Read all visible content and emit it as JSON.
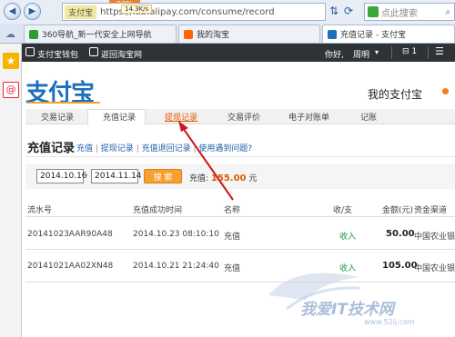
{
  "browser": {
    "progress_badge": "90%",
    "speed": "14.3K/s",
    "addr_tag": "支付宝",
    "url": "https://lab.alipay.com/consume/record",
    "search_placeholder": "点此搜索",
    "tabs": [
      {
        "label": "360导航_新一代安全上网导航"
      },
      {
        "label": "我的淘宝"
      },
      {
        "label": "充值记录 - 支付宝"
      }
    ]
  },
  "topbar": {
    "wallet": "支付宝钱包",
    "back": "返回淘宝网",
    "greeting": "你好,",
    "user": "周明",
    "count": "1"
  },
  "brand": {
    "logo": "支付宝",
    "title": "我的支付宝"
  },
  "nav": [
    "交易记录",
    "充值记录",
    "提现记录",
    "交易评价",
    "电子对账单",
    "记账"
  ],
  "section": {
    "title": "充值记录",
    "links": [
      "充值",
      "提现记录",
      "充值退回记录",
      "使用遇到问题?"
    ]
  },
  "filter": {
    "date_from": "2014.10.16",
    "date_to": "2014.11.14",
    "search": "搜 索",
    "summary_label": "充值:",
    "summary_value": "155.00",
    "summary_unit": "元"
  },
  "table": {
    "headers": [
      "流水号",
      "充值成功时间",
      "名称",
      "收/支",
      "金额(元)",
      "资金渠道"
    ],
    "rows": [
      [
        "20141023AAR90A48",
        "2014.10.23 08:10:10",
        "充值",
        "收入",
        "50.00",
        "中国农业银行"
      ],
      [
        "20141021AA02XN48",
        "2014.10.21 21:24:40",
        "充值",
        "收入",
        "105.00",
        "中国农业银行"
      ]
    ]
  },
  "watermark": {
    "text": "我爱IT技术网",
    "url": "www.52ij.com"
  },
  "colors": {
    "accent_orange": "#f6a030",
    "link_blue": "#1f5fa8",
    "income_green": "#1b9a3a",
    "arrow_red": "#cc1a1a"
  }
}
